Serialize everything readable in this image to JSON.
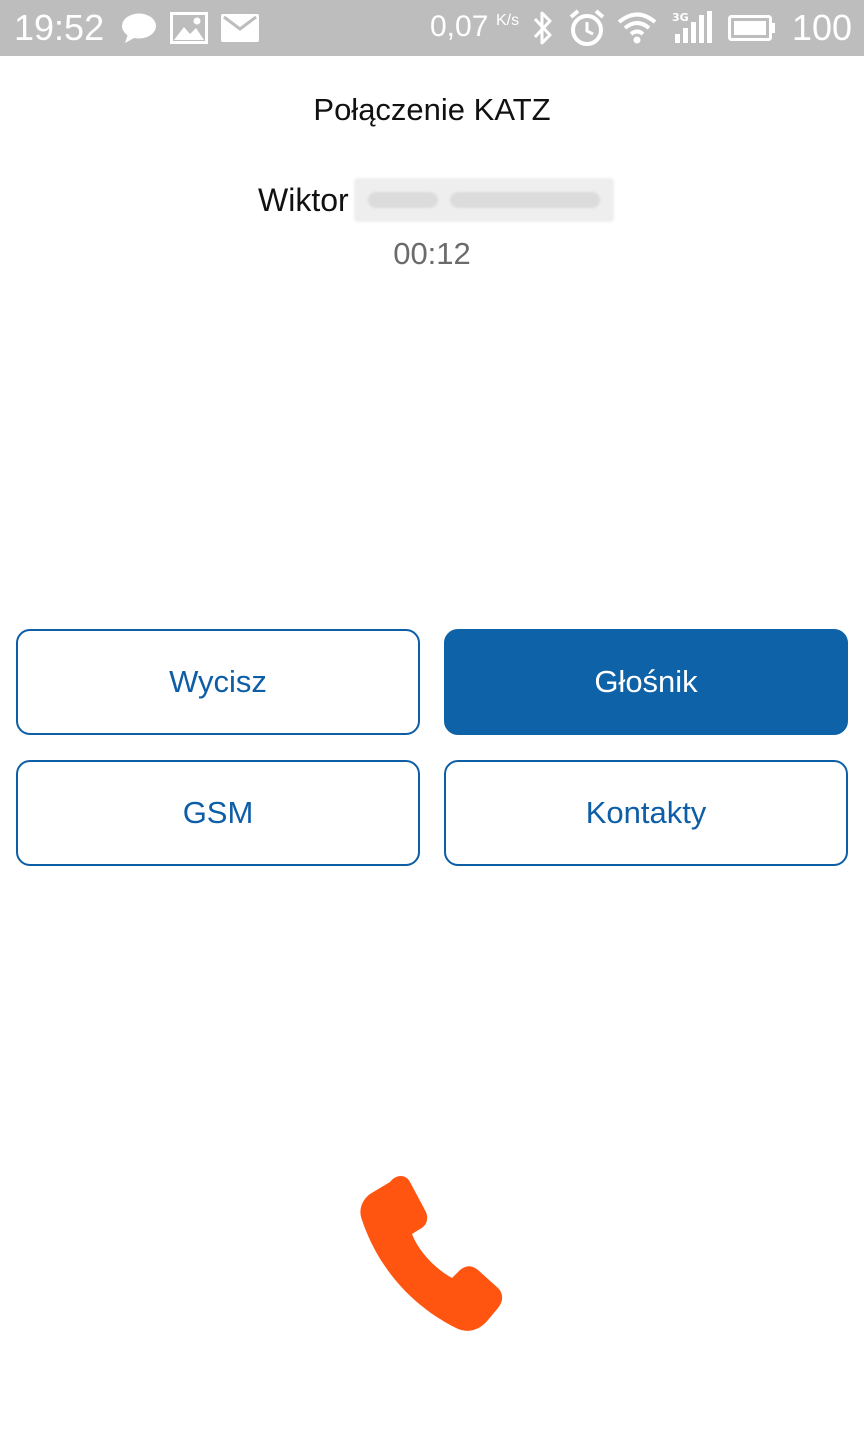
{
  "status_bar": {
    "time": "19:52",
    "network_speed": "0,07",
    "speed_unit": "K/s",
    "battery": "100",
    "icons": [
      "chat-bubble-icon",
      "image-icon",
      "mail-icon",
      "bluetooth-icon",
      "alarm-icon",
      "wifi-icon",
      "3g-signal-icon",
      "battery-icon"
    ]
  },
  "call": {
    "title": "Połączenie KATZ",
    "caller_first_name": "Wiktor",
    "duration": "00:12"
  },
  "controls": {
    "mute_label": "Wycisz",
    "speaker_label": "Głośnik",
    "gsm_label": "GSM",
    "contacts_label": "Kontakty",
    "speaker_active": true
  },
  "hangup": {
    "icon": "phone-hangup-icon",
    "color": "#ff5511"
  },
  "colors": {
    "accent": "#0d5ea6",
    "status_bar": "#bdbdbd"
  }
}
